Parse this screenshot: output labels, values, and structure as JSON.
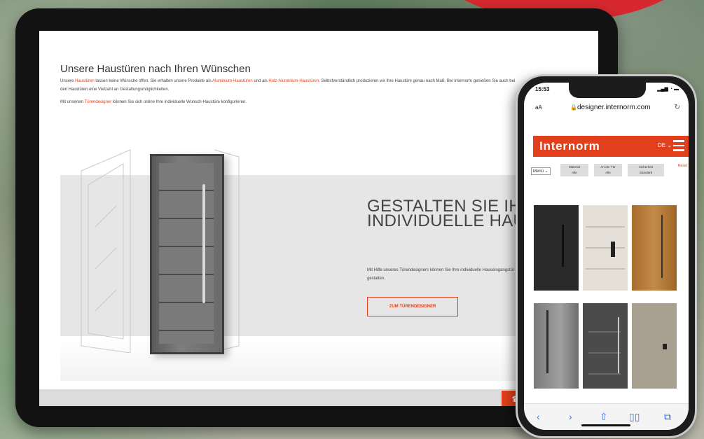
{
  "tablet": {
    "heading": "Unsere Haustüren nach Ihren Wünschen",
    "paragraph1": {
      "t1": "Unsere ",
      "link1": "Haustüren",
      "t2": " lassen keine Wünsche offen. Sie erhalten unsere Produkte als ",
      "link2": "Aluminium-Haustüren",
      "t3": " und als ",
      "link3": "Holz-Aluminium-Haustüren",
      "t4": ". Selbstverständlich produzieren wir Ihre Haustüre genau nach Maß. Bei Internorm genießen Sie auch bei den Haustüren eine Vielzahl an Gestaltungsmöglichkeiten."
    },
    "paragraph2": {
      "t1": "Mit unserem ",
      "link1": "Türendesigner",
      "t2": " können Sie sich online Ihre individuelle Wunsch-Haustüre konfigurieren."
    },
    "hero": {
      "title": "GESTALTEN SIE IHRE INDIVIDUELLE HAUSTÜR",
      "text": "Mit Hilfe unseres Türendesigners können Sie Ihre individuelle Hauseingangstür ganz einfach online gestalten.",
      "cta": "ZUM TÜRENDESIGNER"
    }
  },
  "phone": {
    "time": "15:53",
    "status_icons": "▂▄▆ ◔ ▬",
    "address": {
      "aA": "aA",
      "url": "designer.internorm.com"
    },
    "brand": "Internorm",
    "language": "DE ⌄",
    "filters": {
      "menu": "Menü ⌄",
      "items": [
        {
          "label": "Material",
          "value": "Alle"
        },
        {
          "label": "Art der Tür",
          "value": "Alle"
        },
        {
          "label": "Sicherheit",
          "value": "Standard"
        }
      ],
      "reset": "Reset"
    }
  },
  "colors": {
    "accent": "#e2401c",
    "background_red": "#d8282f"
  }
}
